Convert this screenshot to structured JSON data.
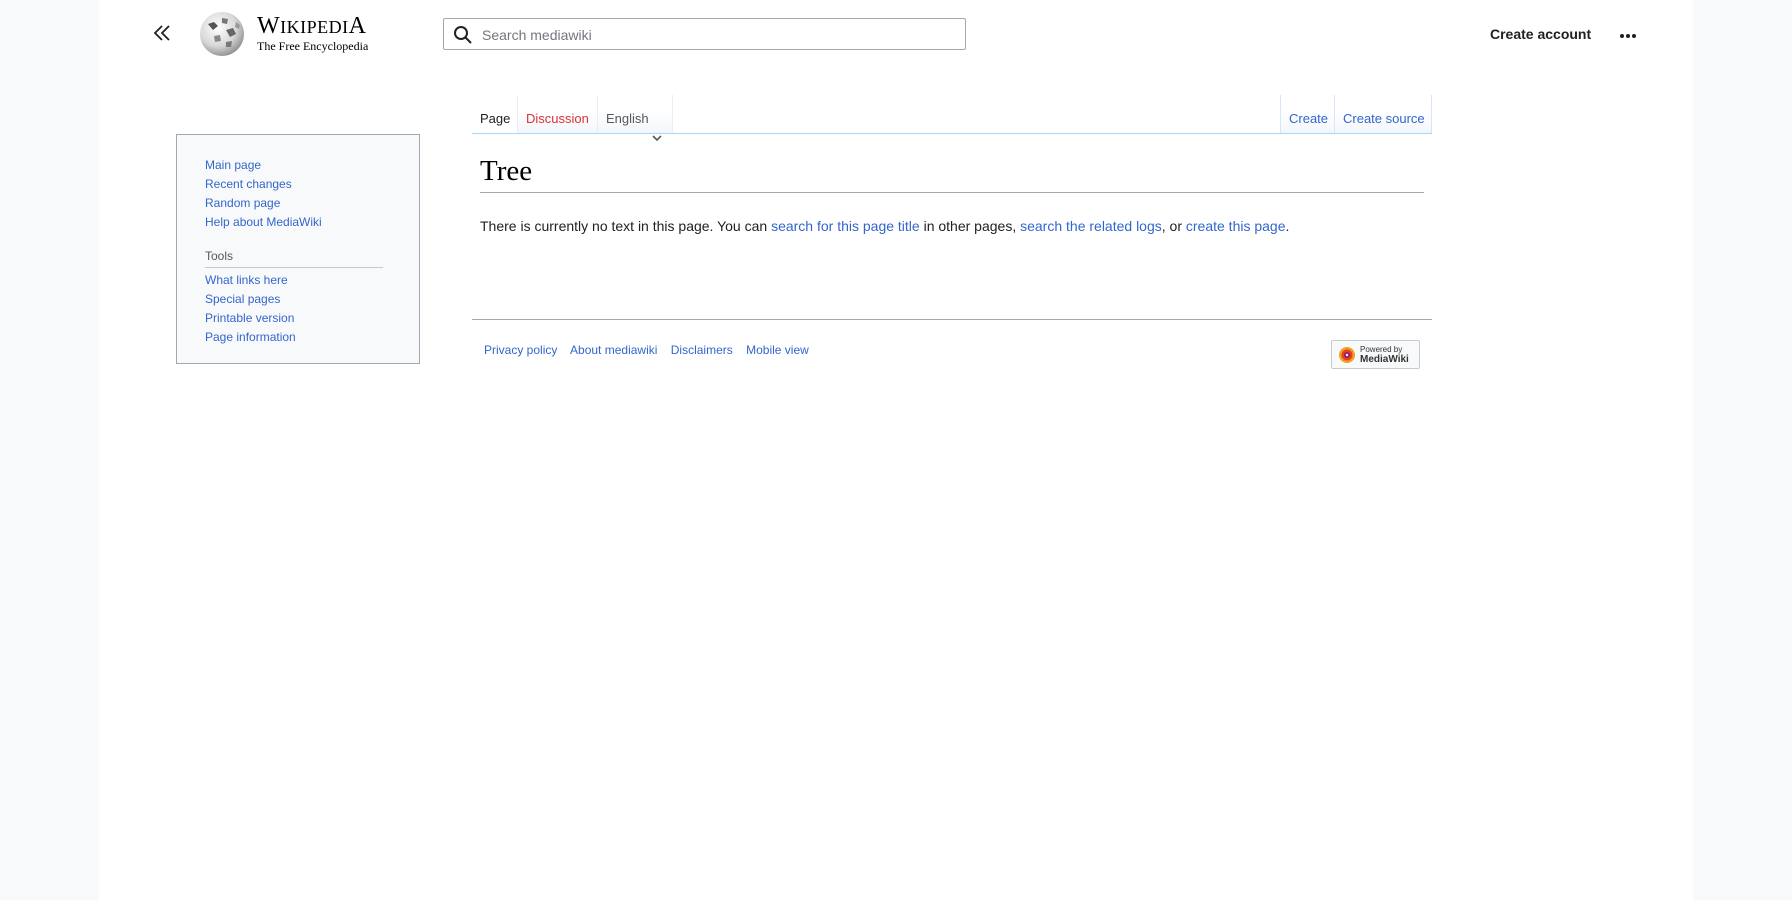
{
  "header": {
    "wordmark_first": "W",
    "wordmark_rest": "IKIPEDI",
    "wordmark_last": "A",
    "tagline": "The Free Encyclopedia",
    "search_placeholder": "Search mediawiki",
    "create_account": "Create account"
  },
  "sidebar": {
    "navigation": [
      {
        "label": "Main page"
      },
      {
        "label": "Recent changes"
      },
      {
        "label": "Random page"
      },
      {
        "label": "Help about MediaWiki"
      }
    ],
    "tools_heading": "Tools",
    "tools": [
      {
        "label": "What links here"
      },
      {
        "label": "Special pages"
      },
      {
        "label": "Printable version"
      },
      {
        "label": "Page information"
      }
    ]
  },
  "tabs": {
    "page": "Page",
    "discussion": "Discussion",
    "language": "English",
    "create": "Create",
    "create_source": "Create source"
  },
  "content": {
    "title": "Tree",
    "text_1": "There is currently no text in this page. You can ",
    "link_1": "search for this page title",
    "text_2": " in other pages, ",
    "link_2": "search the related logs",
    "text_3": ", or ",
    "link_3": "create this page",
    "text_4": "."
  },
  "footer": {
    "links": [
      {
        "label": "Privacy policy"
      },
      {
        "label": "About mediawiki"
      },
      {
        "label": "Disclaimers"
      },
      {
        "label": "Mobile view"
      }
    ],
    "powered_small": "Powered by",
    "powered_big": "MediaWiki"
  },
  "colors": {
    "link": "#3366cc",
    "new_link": "#d33",
    "background": "#f8f9fa"
  }
}
